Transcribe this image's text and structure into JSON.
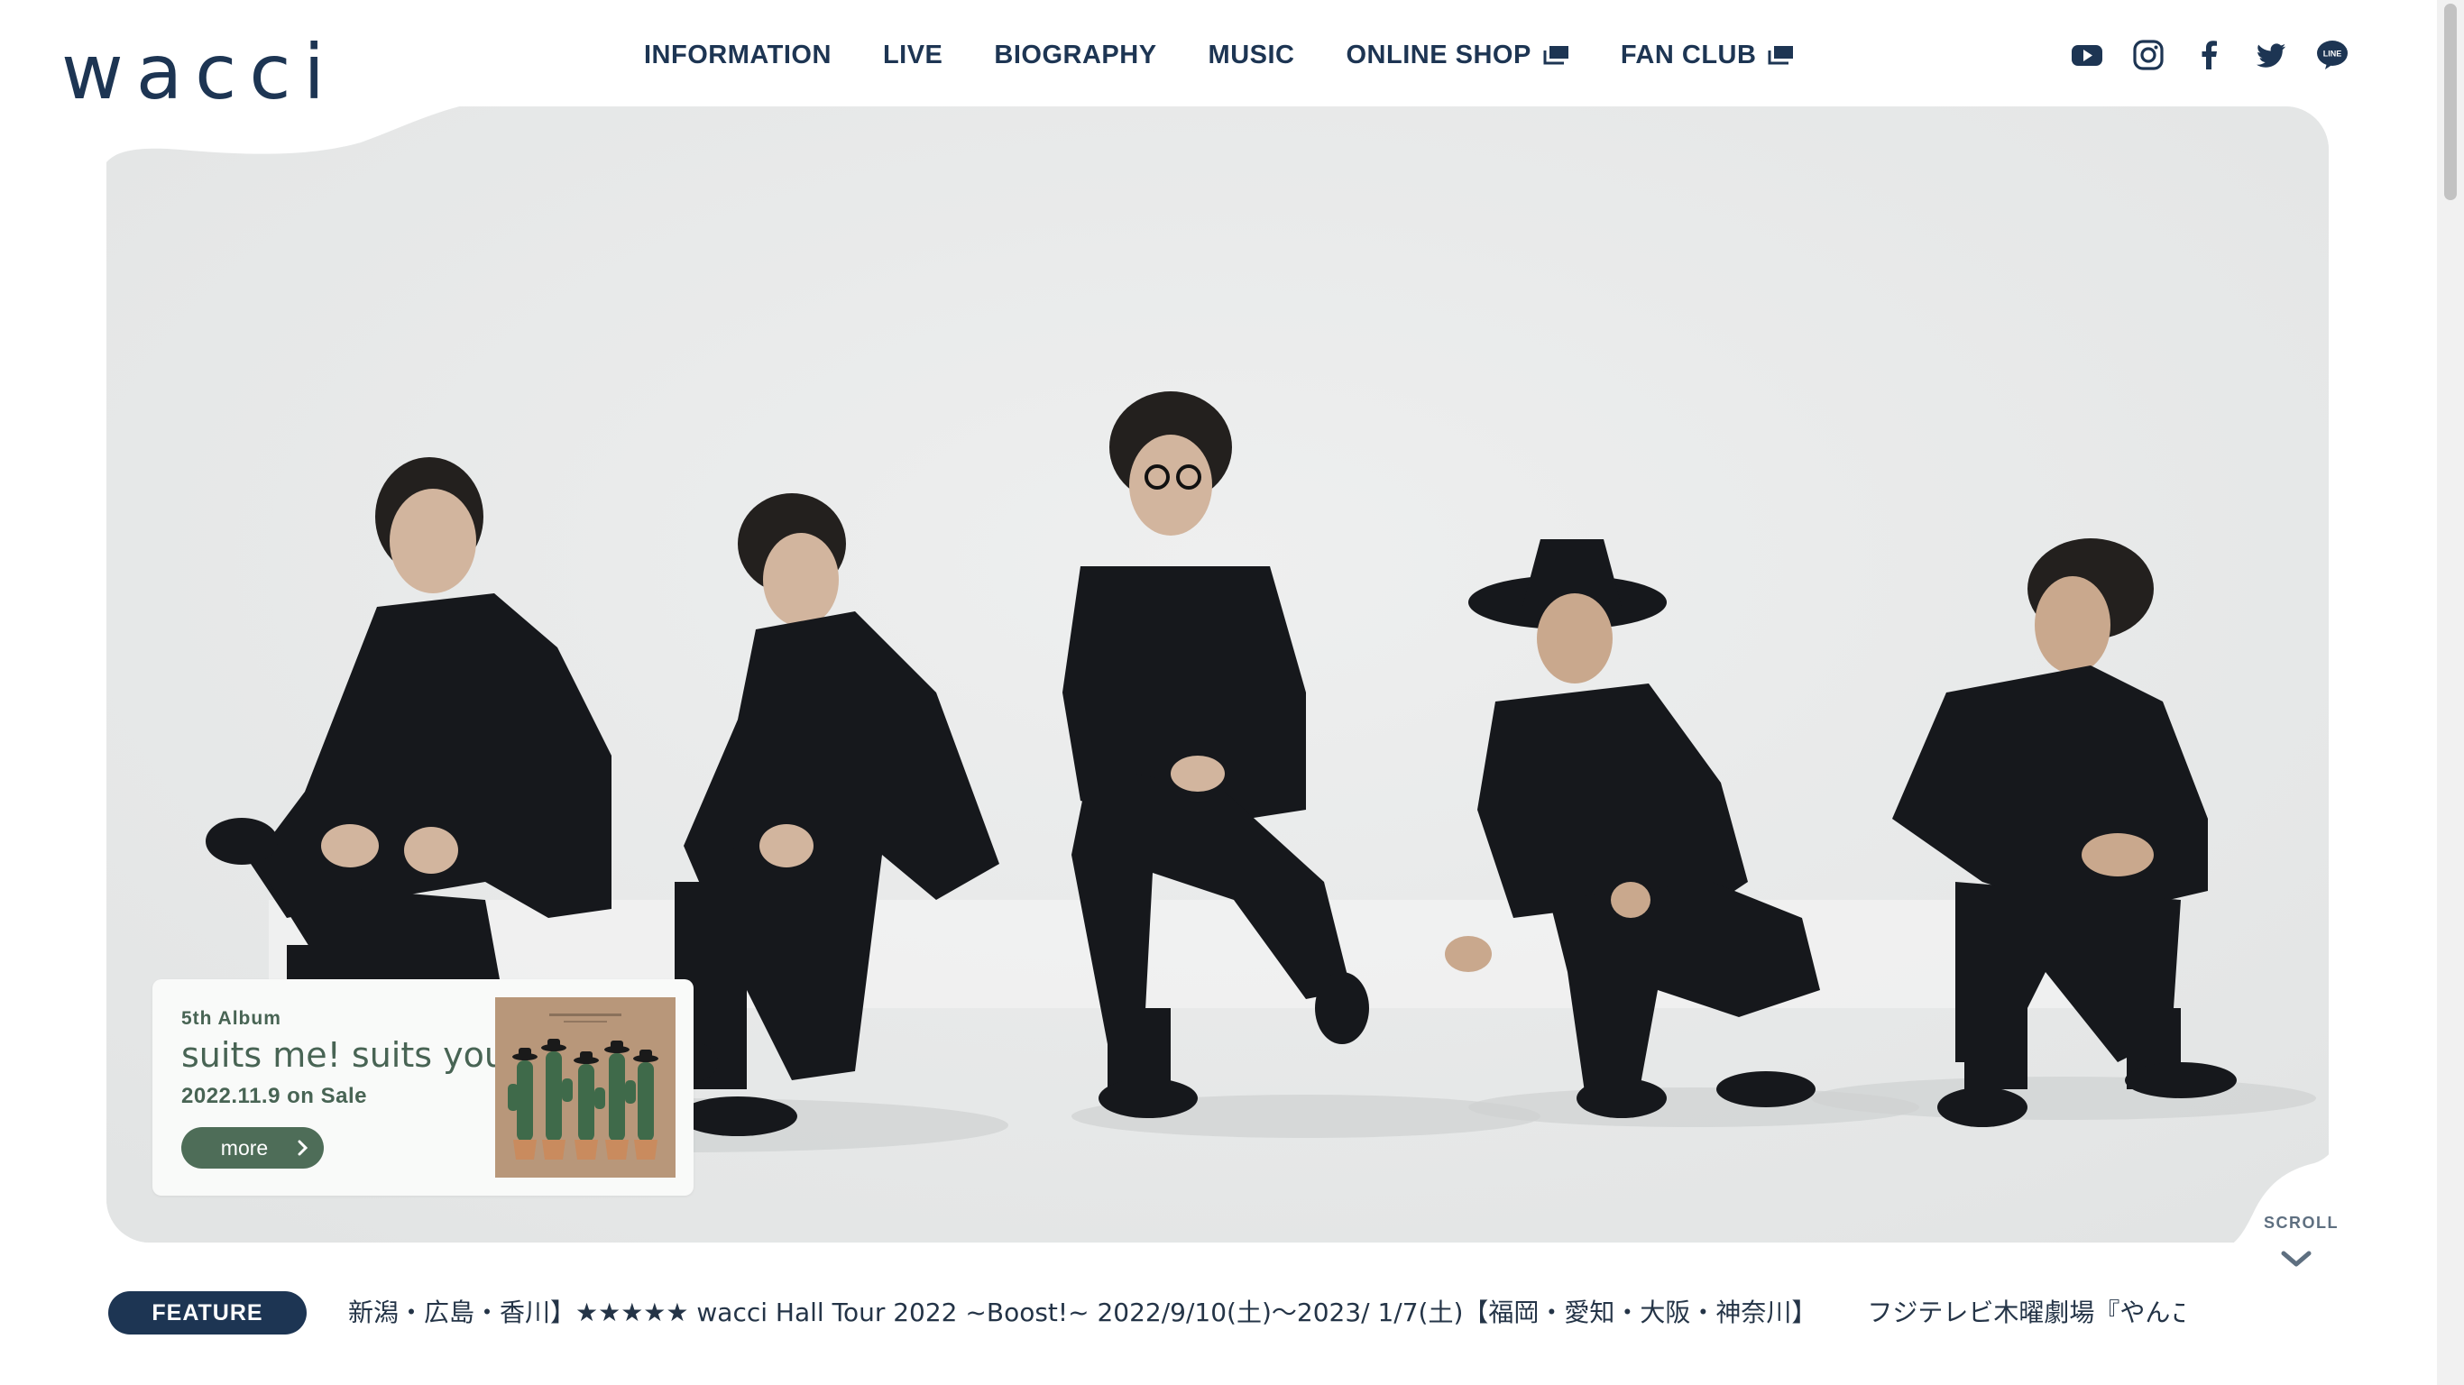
{
  "site": {
    "logo_text": "wacci"
  },
  "nav": {
    "items": [
      {
        "label": "INFORMATION",
        "external": false
      },
      {
        "label": "LIVE",
        "external": false
      },
      {
        "label": "BIOGRAPHY",
        "external": false
      },
      {
        "label": "MUSIC",
        "external": false
      },
      {
        "label": "ONLINE SHOP",
        "external": true
      },
      {
        "label": "FAN CLUB",
        "external": true
      }
    ]
  },
  "sns": [
    "youtube-icon",
    "instagram-icon",
    "facebook-icon",
    "twitter-icon",
    "line-icon"
  ],
  "hero": {
    "image": "Band photo: five members in black suits seated against a light grey studio background"
  },
  "album_card": {
    "subtitle": "5th Album",
    "title": "suits me! suits you!",
    "release": "2022.11.9 on Sale",
    "button": "more"
  },
  "scroll": {
    "label": "SCROLL"
  },
  "feature": {
    "badge": "FEATURE",
    "items": [
      "新潟・広島・香川】★★★★★ wacci Hall Tour 2022 ~Boost!~ 2022/9/10(土)〜2023/ 1/7(土)【福岡・愛知・大阪・神奈川】",
      "フジテレビ木曜劇場『やんごとなき一族』"
    ]
  },
  "colors": {
    "navy": "#1d3553",
    "green": "#4e6d58",
    "hero_bg": "#ebecec"
  }
}
